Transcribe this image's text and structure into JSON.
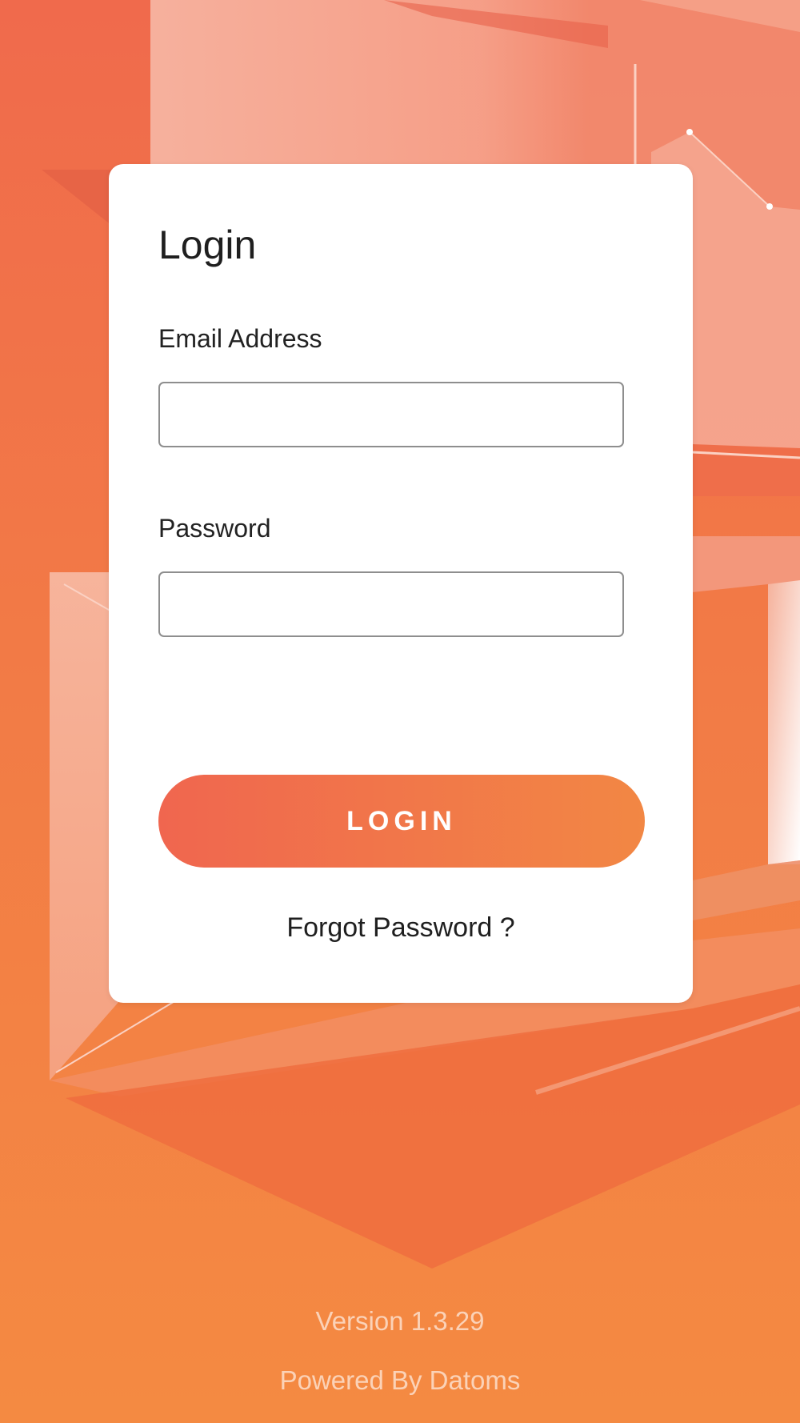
{
  "login_card": {
    "title": "Login",
    "email_label": "Email Address",
    "email_value": "",
    "password_label": "Password",
    "password_value": "",
    "login_button_label": "LOGIN",
    "forgot_password_label": "Forgot Password ?"
  },
  "footer": {
    "version": "Version 1.3.29",
    "powered_by": "Powered By Datoms"
  },
  "colors": {
    "background_top": "#f06a4c",
    "background_bottom": "#f48a42",
    "button_gradient_start": "#f0664f",
    "button_gradient_end": "#f28744",
    "card": "#ffffff"
  }
}
